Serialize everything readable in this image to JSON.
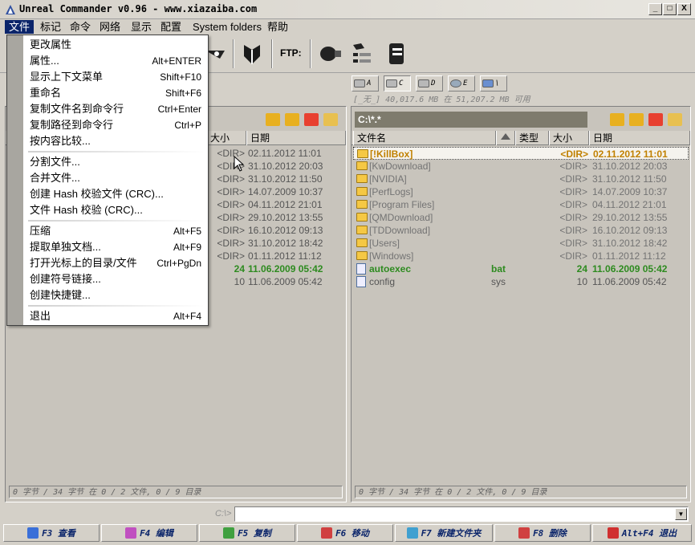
{
  "window": {
    "title": "Unreal Commander v0.96 - www.xiazaiba.com",
    "buttons": [
      "_",
      "□",
      "X"
    ]
  },
  "menubar": {
    "items": [
      {
        "label": "文件",
        "active": true
      },
      {
        "label": "标记"
      },
      {
        "label": "命令"
      },
      {
        "label": "网络"
      },
      {
        "label": "显示"
      },
      {
        "label": "配置"
      },
      {
        "label": "System folders"
      },
      {
        "label": "帮助"
      }
    ]
  },
  "toolbar": {
    "ftp_label": "FTP:"
  },
  "drives": [
    {
      "letter": "A",
      "pressed": false
    },
    {
      "letter": "C",
      "pressed": true
    },
    {
      "letter": "D",
      "pressed": false
    },
    {
      "letter": "E",
      "pressed": false
    },
    {
      "letter": "\\",
      "pressed": false
    }
  ],
  "drive_info": "[_无_]  40,017.6 MB 在 51,207.2 MB 可用",
  "file_menu": {
    "items": [
      {
        "label": "更改属性",
        "shortcut": ""
      },
      {
        "label": "属性...",
        "shortcut": "Alt+ENTER"
      },
      {
        "label": "显示上下文菜单",
        "shortcut": "Shift+F10"
      },
      {
        "label": "重命名",
        "shortcut": "Shift+F6"
      },
      {
        "label": "复制文件名到命令行",
        "shortcut": "Ctrl+Enter"
      },
      {
        "label": "复制路径到命令行",
        "shortcut": "Ctrl+P"
      },
      {
        "label": "按内容比较...",
        "shortcut": ""
      },
      {
        "label": "分割文件...",
        "shortcut": ""
      },
      {
        "label": "合并文件...",
        "shortcut": ""
      },
      {
        "label": "创建 Hash 校验文件 (CRC)...",
        "shortcut": ""
      },
      {
        "label": "文件 Hash 校验 (CRC)...",
        "shortcut": ""
      },
      {
        "label": "压缩",
        "shortcut": "Alt+F5"
      },
      {
        "label": "提取单独文档...",
        "shortcut": "Alt+F9"
      },
      {
        "label": "打开光标上的目录/文件",
        "shortcut": "Ctrl+PgDn"
      },
      {
        "label": "创建符号链接...",
        "shortcut": ""
      },
      {
        "label": "创建快捷键...",
        "shortcut": ""
      },
      {
        "label": "退出",
        "shortcut": "Alt+F4"
      }
    ]
  },
  "left_panel": {
    "headers": {
      "size": "大小",
      "date": "日期"
    },
    "rows": [
      {
        "size": "<DIR>",
        "date": "02.11.2012 11:01"
      },
      {
        "size": "<DIR>",
        "date": "31.10.2012 20:03"
      },
      {
        "size": "<DIR>",
        "date": "31.10.2012 11:50"
      },
      {
        "size": "<DIR>",
        "date": "14.07.2009 10:37"
      },
      {
        "size": "<DIR>",
        "date": "04.11.2012 21:01"
      },
      {
        "size": "<DIR>",
        "date": "29.10.2012 13:55"
      },
      {
        "size": "<DIR>",
        "date": "16.10.2012 09:13"
      },
      {
        "size": "<DIR>",
        "date": "31.10.2012 18:42"
      },
      {
        "size": "<DIR>",
        "date": "01.11.2012 11:12"
      },
      {
        "size": "24",
        "date": "11.06.2009 05:42",
        "green": true
      },
      {
        "size": "10",
        "date": "11.06.2009 05:42"
      }
    ],
    "status": "0 字节 / 34 字节 在 0 / 2 文件, 0 / 9 目录"
  },
  "right_panel": {
    "path": "C:\\*.*",
    "headers": {
      "name": "文件名",
      "type": "类型",
      "size": "大小",
      "date": "日期"
    },
    "rows": [
      {
        "name": "[!KillBox]",
        "type": "",
        "size": "<DIR>",
        "date": "02.11.2012 11:01",
        "kind": "folder",
        "selected": true
      },
      {
        "name": "[KwDownload]",
        "type": "",
        "size": "<DIR>",
        "date": "31.10.2012 20:03",
        "kind": "folder"
      },
      {
        "name": "[NVIDIA]",
        "type": "",
        "size": "<DIR>",
        "date": "31.10.2012 11:50",
        "kind": "folder"
      },
      {
        "name": "[PerfLogs]",
        "type": "",
        "size": "<DIR>",
        "date": "14.07.2009 10:37",
        "kind": "folder"
      },
      {
        "name": "[Program Files]",
        "type": "",
        "size": "<DIR>",
        "date": "04.11.2012 21:01",
        "kind": "folder"
      },
      {
        "name": "[QMDownload]",
        "type": "",
        "size": "<DIR>",
        "date": "29.10.2012 13:55",
        "kind": "folder"
      },
      {
        "name": "[TDDownload]",
        "type": "",
        "size": "<DIR>",
        "date": "16.10.2012 09:13",
        "kind": "folder"
      },
      {
        "name": "[Users]",
        "type": "",
        "size": "<DIR>",
        "date": "31.10.2012 18:42",
        "kind": "folder"
      },
      {
        "name": "[Windows]",
        "type": "",
        "size": "<DIR>",
        "date": "01.11.2012 11:12",
        "kind": "folder"
      },
      {
        "name": "autoexec",
        "type": "bat",
        "size": "24",
        "date": "11.06.2009 05:42",
        "kind": "file",
        "green": true
      },
      {
        "name": "config",
        "type": "sys",
        "size": "10",
        "date": "11.06.2009 05:42",
        "kind": "file"
      }
    ],
    "status": "0 字节 / 34 字节 在 0 / 2 文件, 0 / 9 目录"
  },
  "command_line": {
    "label": "C:\\>"
  },
  "function_keys": [
    {
      "label": "F3 查看",
      "color": "#3a6fd8"
    },
    {
      "label": "F4 编辑",
      "color": "#c050c0"
    },
    {
      "label": "F5 复制",
      "color": "#40a040"
    },
    {
      "label": "F6 移动",
      "color": "#d04040"
    },
    {
      "label": "F7 新建文件夹",
      "color": "#40a0d0"
    },
    {
      "label": "F8 删除",
      "color": "#d04040"
    },
    {
      "label": "Alt+F4 退出",
      "color": "#d03030"
    }
  ]
}
